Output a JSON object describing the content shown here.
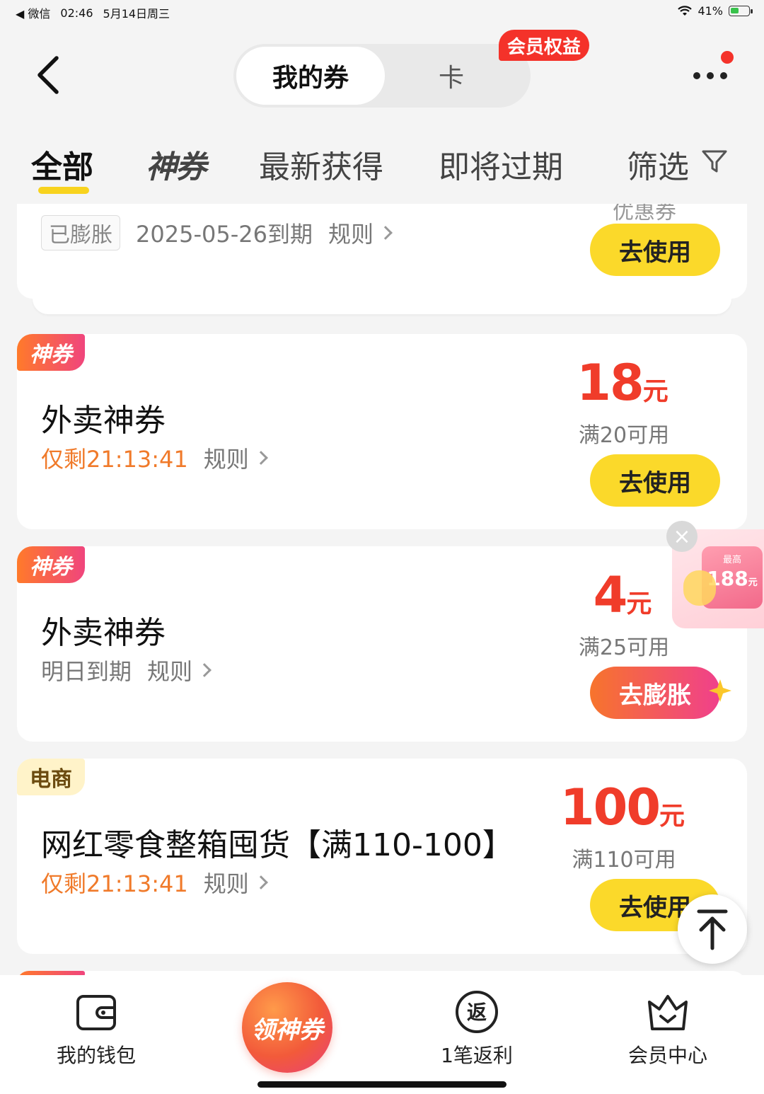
{
  "status_bar": {
    "back_app": "◀ 微信",
    "time": "02:46",
    "date": "5月14日周三",
    "battery": "41%",
    "battery_level": 0.41
  },
  "header": {
    "segments": [
      "我的券",
      "卡"
    ],
    "member_badge": "会员权益"
  },
  "filters": {
    "tabs": [
      "全部",
      "神券",
      "最新获得",
      "即将过期",
      "筛选"
    ]
  },
  "cards": [
    {
      "status_badge": "已膨胀",
      "expiry": "2025-05-26到期",
      "rules": "规则",
      "partial_text": "优惠券",
      "button": "去使用"
    },
    {
      "tag": "神券",
      "title": "外卖神券",
      "countdown": "仅剩21:13:41",
      "rules": "规则",
      "amount": "18",
      "unit": "元",
      "threshold": "满20可用",
      "button": "去使用"
    },
    {
      "tag": "神券",
      "title": "外卖神券",
      "expiry": "明日到期",
      "rules": "规则",
      "amount": "4",
      "unit": "元",
      "threshold": "满25可用",
      "button": "去膨胀"
    },
    {
      "tag": "电商",
      "title": "网红零食整箱囤货【满110-100】",
      "countdown": "仅剩21:13:41",
      "rules": "规则",
      "amount": "100",
      "unit": "元",
      "threshold": "满110可用",
      "button": "去使用"
    }
  ],
  "floating_promo": {
    "top_text": "最高",
    "amount": "188",
    "unit": "元"
  },
  "bottom_nav": {
    "items": [
      "我的钱包",
      "1笔返利",
      "会员中心"
    ],
    "center_cta": "领神券",
    "rebate_glyph": "返"
  },
  "colors": {
    "accent_yellow": "#fbd92a",
    "price_red": "#f03c2a",
    "countdown_orange": "#f07a2a",
    "brand_gradient_start": "#ff7a2a",
    "brand_gradient_end": "#f0457d"
  }
}
